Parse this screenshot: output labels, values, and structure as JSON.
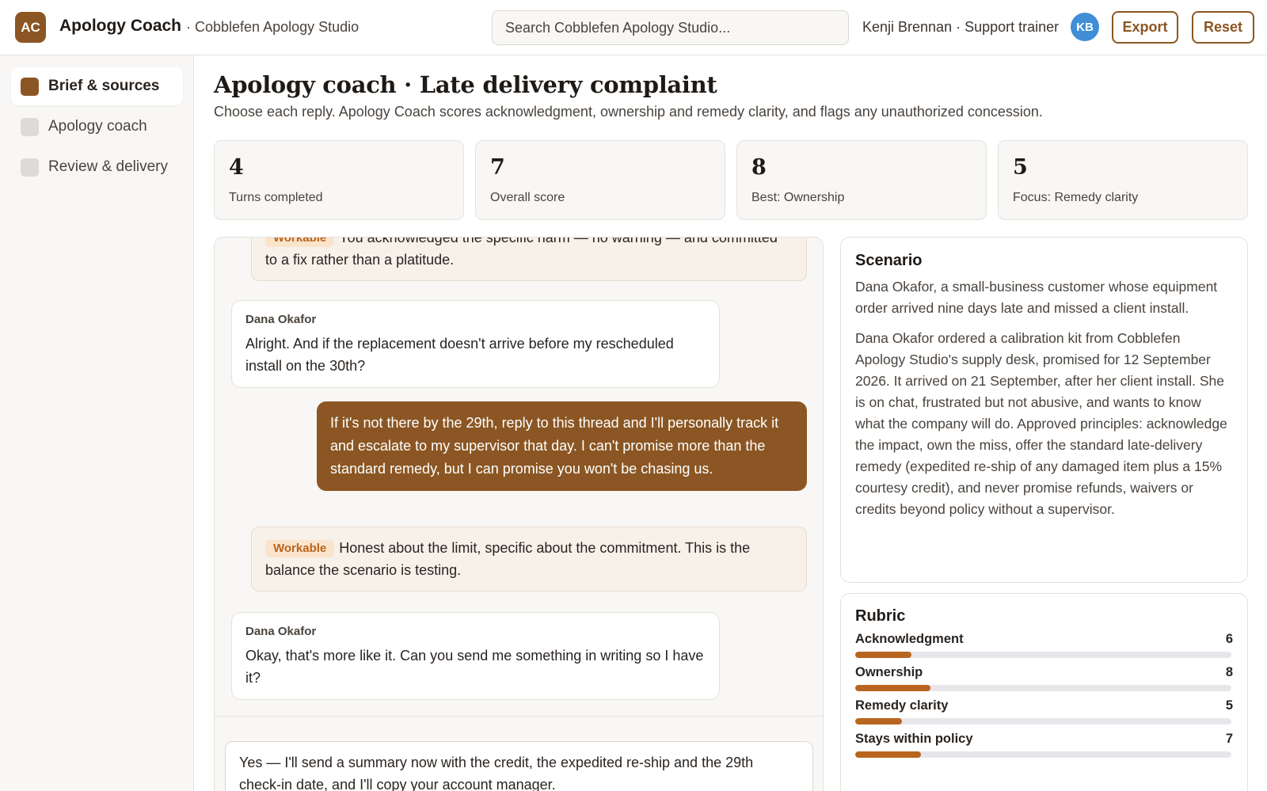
{
  "app": {
    "logo_initials": "AC",
    "title": "Apology Coach",
    "workspace": "· Cobblefen Apology Studio",
    "search_placeholder": "Search Cobblefen Apology Studio...",
    "user_label": "Kenji Brennan · Support trainer",
    "user_initials": "KB",
    "export_label": "Export",
    "reset_label": "Reset",
    "accent_color": "#8b5623"
  },
  "sidebar": {
    "items": [
      {
        "label": "Brief & sources",
        "active": true
      },
      {
        "label": "Apology coach",
        "active": false
      },
      {
        "label": "Review & delivery",
        "active": false
      }
    ]
  },
  "page": {
    "title": "Apology coach · Late delivery complaint",
    "subtitle": "Choose each reply. Apology Coach scores acknowledgment, ownership and remedy clarity, and flags any unauthorized concession."
  },
  "stats": [
    {
      "value": "4",
      "label": "Turns completed"
    },
    {
      "value": "7",
      "label": "Overall score"
    },
    {
      "value": "8",
      "label": "Best: Ownership"
    },
    {
      "value": "5",
      "label": "Focus: Remedy clarity"
    }
  ],
  "chat": {
    "feedback_1": {
      "badge": "Workable",
      "text": "You acknowledged the specific harm — no warning — and committed to a fix rather than a platitude."
    },
    "customer_1": {
      "speaker": "Dana Okafor",
      "text": "Alright. And if the replacement doesn't arrive before my rescheduled install on the 30th?"
    },
    "agent_1": {
      "text": "If it's not there by the 29th, reply to this thread and I'll personally track it and escalate to my supervisor that day. I can't promise more than the standard remedy, but I can promise you won't be chasing us."
    },
    "feedback_2": {
      "badge": "Workable",
      "text": "Honest about the limit, specific about the commitment. This is the balance the scenario is testing."
    },
    "customer_2": {
      "speaker": "Dana Okafor",
      "text": "Okay, that's more like it. Can you send me something in writing so I have it?"
    },
    "composer_text": "Yes — I'll send a summary now with the credit, the expedited re-ship and the 29th check-in date, and I'll copy your account manager."
  },
  "scenario": {
    "title": "Scenario",
    "summary": "Dana Okafor, a small-business customer whose equipment order arrived nine days late and missed a client install.",
    "details": "Dana Okafor ordered a calibration kit from Cobblefen Apology Studio's supply desk, promised for 12 September 2026. It arrived on 21 September, after her client install. She is on chat, frustrated but not abusive, and wants to know what the company will do. Approved principles: acknowledge the impact, own the miss, offer the standard late-delivery remedy (expedited re-ship of any damaged item plus a 15% courtesy credit), and never promise refunds, waivers or credits beyond policy without a supervisor."
  },
  "rubric": {
    "title": "Rubric",
    "max_score": 10,
    "items": [
      {
        "name": "Acknowledgment",
        "score": 6
      },
      {
        "name": "Ownership",
        "score": 8
      },
      {
        "name": "Remedy clarity",
        "score": 5
      },
      {
        "name": "Stays within policy",
        "score": 7
      }
    ]
  }
}
